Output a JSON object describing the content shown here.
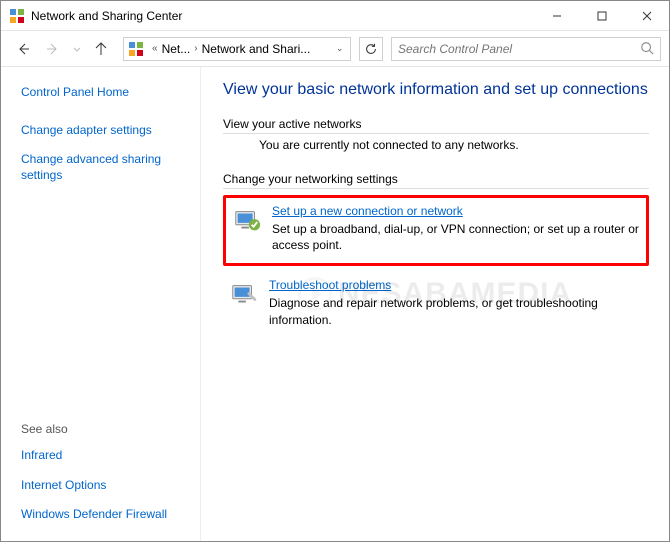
{
  "window": {
    "title": "Network and Sharing Center"
  },
  "breadcrumb": {
    "seg1": "Net...",
    "seg2": "Network and Shari..."
  },
  "search": {
    "placeholder": "Search Control Panel"
  },
  "sidebar": {
    "home": "Control Panel Home",
    "adapter": "Change adapter settings",
    "advanced": "Change advanced sharing settings",
    "see_also_label": "See also",
    "infrared": "Infrared",
    "internet_options": "Internet Options",
    "firewall": "Windows Defender Firewall"
  },
  "main": {
    "heading": "View your basic network information and set up connections",
    "active_label": "View your active networks",
    "active_msg": "You are currently not connected to any networks.",
    "change_label": "Change your networking settings",
    "setup_link": "Set up a new connection or network",
    "setup_desc": "Set up a broadband, dial-up, or VPN connection; or set up a router or access point.",
    "troubleshoot_link": "Troubleshoot problems",
    "troubleshoot_desc": "Diagnose and repair network problems, or get troubleshooting information."
  },
  "watermark": "NESABAMEDIA"
}
